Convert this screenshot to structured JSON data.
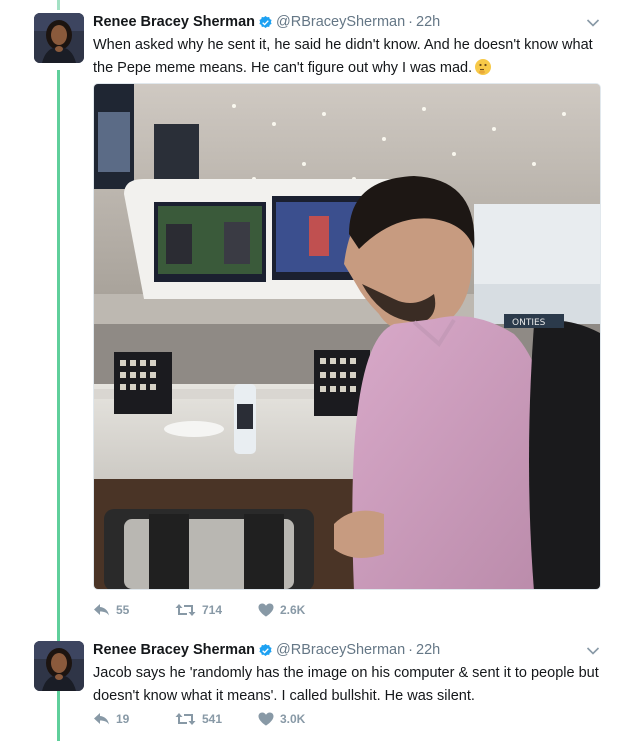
{
  "tweets": [
    {
      "author_name": "Renee Bracey Sherman",
      "handle": "@RBraceySherman",
      "time": "22h",
      "text": "When asked why he sent it, he said he didn't know. And he doesn't know what the Pepe meme means. He can't figure out why I was mad.",
      "emoji_icon": "thinking-face-emoji",
      "reply_count": "55",
      "retweet_count": "714",
      "like_count": "2.6K"
    },
    {
      "author_name": "Renee Bracey Sherman",
      "handle": "@RBraceySherman",
      "time": "22h",
      "text": "Jacob says he 'randomly has the image on his computer & sent it to people but doesn't know what it means'. I called bullshit. He was silent.",
      "reply_count": "19",
      "retweet_count": "541",
      "like_count": "3.0K"
    }
  ],
  "icons": {
    "verified": "verified-badge-icon",
    "caret": "chevron-down-icon",
    "reply": "reply-icon",
    "retweet": "retweet-icon",
    "like": "heart-icon"
  },
  "colors": {
    "thread_line": "#5fcf9b",
    "verified": "#1da1f2",
    "action_gray": "#8899a6",
    "handle_gray": "#657786"
  }
}
